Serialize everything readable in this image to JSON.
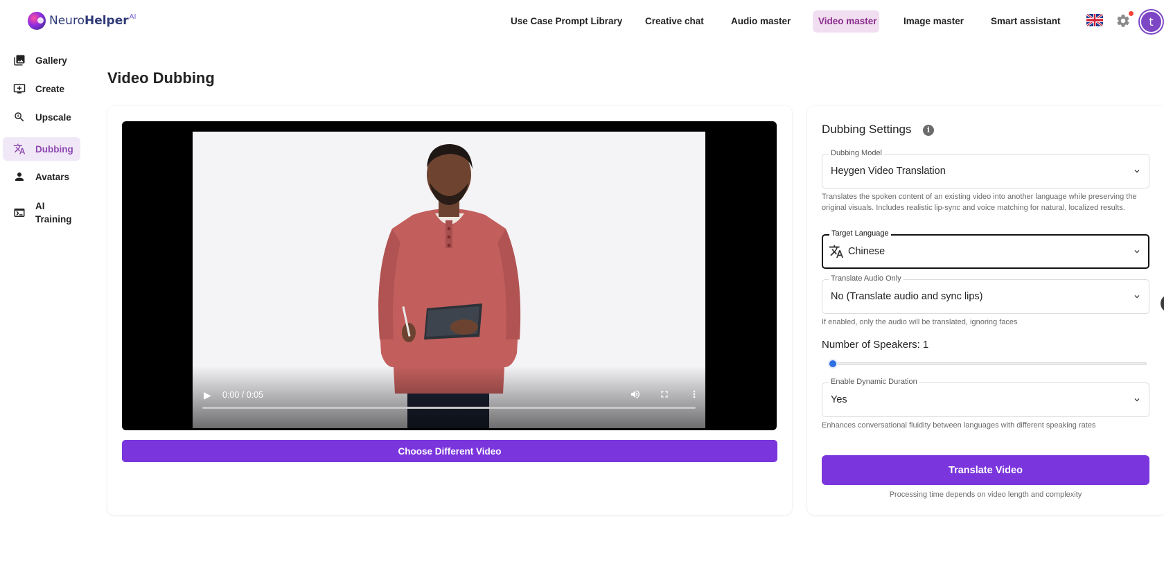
{
  "brand": {
    "name_part1": "Neuro",
    "name_part2": "Helper",
    "superscript": "AI"
  },
  "nav": {
    "items": [
      {
        "label": "Use Case Prompt Library",
        "active": false
      },
      {
        "label": "Creative chat",
        "active": false
      },
      {
        "label": "Audio master",
        "active": false
      },
      {
        "label": "Video master",
        "active": true
      },
      {
        "label": "Image master",
        "active": false
      },
      {
        "label": "Smart assistant",
        "active": false
      }
    ],
    "language_icon": "uk-flag-icon",
    "settings_icon": "gear-icon",
    "notification_indicator": true,
    "avatar_initial": "t"
  },
  "sidebar": {
    "items": [
      {
        "label": "Gallery",
        "icon": "gallery-icon",
        "active": false
      },
      {
        "label": "Create",
        "icon": "create-icon",
        "active": false
      },
      {
        "label": "Upscale",
        "icon": "zoom-icon",
        "active": false
      },
      {
        "label": "Dubbing",
        "icon": "translate-icon",
        "active": true
      },
      {
        "label": "Avatars",
        "icon": "person-icon",
        "active": false
      },
      {
        "label": "AI\nTraining",
        "icon": "terminal-icon",
        "active": false
      }
    ]
  },
  "page": {
    "title": "Video Dubbing"
  },
  "video": {
    "time_display": "0:00 / 0:05",
    "progress": 0,
    "choose_button_label": "Choose Different Video"
  },
  "settings": {
    "title": "Dubbing Settings",
    "dubbing_model": {
      "label": "Dubbing Model",
      "value": "Heygen Video Translation",
      "helper": "Translates the spoken content of an existing video into another language while preserving the original visuals. Includes realistic lip-sync and voice matching for natural, localized results."
    },
    "target_language": {
      "label": "Target Language",
      "value": "Chinese"
    },
    "translate_audio_only": {
      "label": "Translate Audio Only",
      "value": "No (Translate audio and sync lips)",
      "helper": "If enabled, only the audio will be translated, ignoring faces"
    },
    "speakers": {
      "label": "Number of Speakers: 1",
      "value": 1
    },
    "dynamic_duration": {
      "label": "Enable Dynamic Duration",
      "value": "Yes",
      "helper": "Enhances conversational fluidity between languages with different speaking rates"
    },
    "translate_button_label": "Translate Video",
    "processing_note": "Processing time depends on video length and complexity"
  },
  "colors": {
    "accent": "#7a35dc",
    "nav_active_bg": "#f1def0",
    "nav_active_text": "#8b2c8f",
    "sidebar_active_bg": "#f1e8f7",
    "slider_thumb": "#2f6fe4"
  }
}
